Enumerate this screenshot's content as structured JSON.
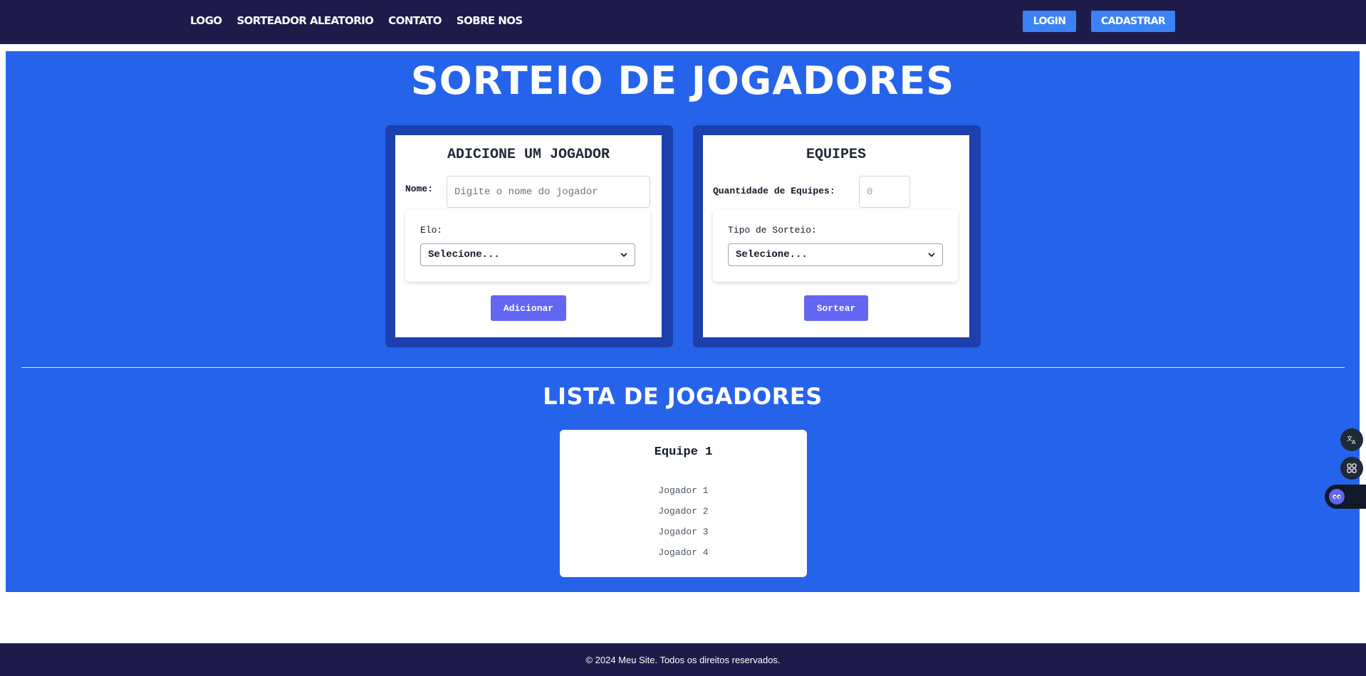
{
  "nav": {
    "links": [
      "LOGO",
      "SORTEADOR ALEATORIO",
      "CONTATO",
      "SOBRE NOS"
    ],
    "login_label": "LOGIN",
    "signup_label": "CADASTRAR"
  },
  "main": {
    "title": "SORTEIO DE JOGADORES",
    "add_player": {
      "title": "ADICIONE UM JOGADOR",
      "name_label": "Nome:",
      "name_placeholder": "Digite o nome do jogador",
      "elo_label": "Elo:",
      "elo_selected": "Selecione...",
      "button_label": "Adicionar"
    },
    "teams": {
      "title": "EQUIPES",
      "count_label": "Quantidade de Equipes:",
      "count_value": "0",
      "draw_type_label": "Tipo de Sorteio:",
      "draw_type_selected": "Selecione...",
      "button_label": "Sortear"
    },
    "list_title": "LISTA DE JOGADORES",
    "team_card": {
      "name": "Equipe 1",
      "players": [
        "Jogador 1",
        "Jogador 2",
        "Jogador 3",
        "Jogador 4"
      ]
    }
  },
  "footer": {
    "text": "© 2024 Meu Site. Todos os direitos reservados."
  },
  "floating": [
    "translate-icon",
    "apps-icon",
    "assistant-icon"
  ],
  "colors": {
    "navbar": "#1e1b4b",
    "main_bg": "#2563eb",
    "card_frame": "#1d40af",
    "auth_button": "#3b82f6",
    "action_button": "#6366f1"
  }
}
